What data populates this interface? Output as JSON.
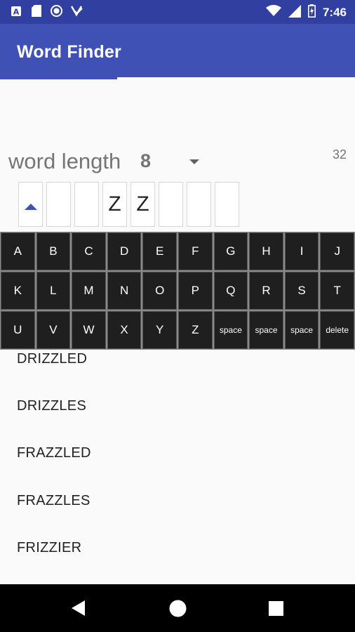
{
  "status_bar": {
    "time": "7:46",
    "left_icons": [
      "a-box-icon",
      "sd-card-icon",
      "circle-record-icon",
      "download-check-icon"
    ],
    "right_icons": [
      "wifi-icon",
      "signal-icon",
      "battery-icon"
    ]
  },
  "app": {
    "title": "Word Finder",
    "progress_fraction": 0.33
  },
  "controls": {
    "word_length_label": "word length",
    "word_length_value": "8",
    "result_count": "32"
  },
  "slots": [
    "",
    "",
    "",
    "Z",
    "Z",
    "",
    "",
    ""
  ],
  "keyboard": {
    "rows": [
      [
        "A",
        "B",
        "C",
        "D",
        "E",
        "F",
        "G",
        "H",
        "I",
        "J"
      ],
      [
        "K",
        "L",
        "M",
        "N",
        "O",
        "P",
        "Q",
        "R",
        "S",
        "T"
      ],
      [
        "U",
        "V",
        "W",
        "X",
        "Y",
        "Z",
        "space",
        "space",
        "space",
        "delete"
      ]
    ]
  },
  "results": [
    "DRIZZLED",
    "DRIZZLES",
    "FRAZZLED",
    "FRAZZLES",
    "FRIZZIER"
  ],
  "colors": {
    "primary": "#3f51b5",
    "primary_dark": "#3140a0",
    "key_bg": "#1f1f1f"
  }
}
